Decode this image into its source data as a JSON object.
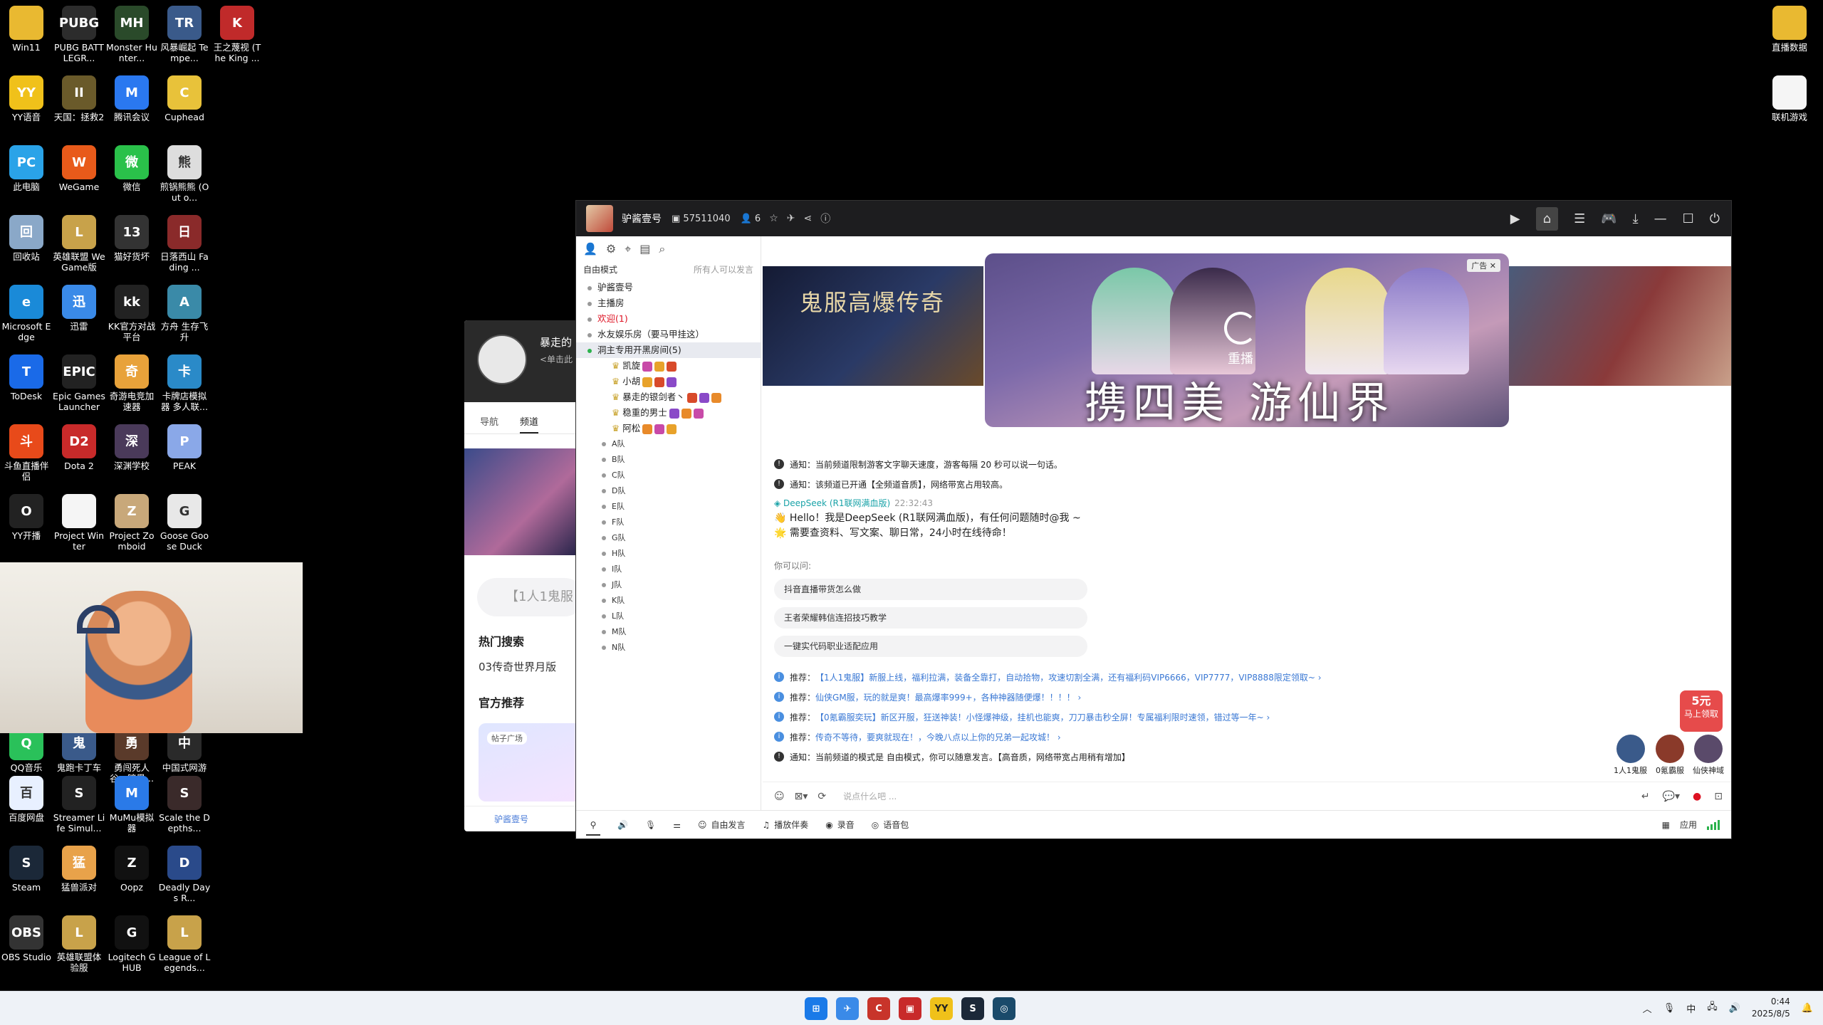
{
  "desktop": {
    "icons_left": [
      {
        "label": "Win11",
        "color": "#e9b931",
        "glyph": ""
      },
      {
        "label": "PUBG BATTLEGR...",
        "color": "#2c2c2c",
        "glyph": "PUBG"
      },
      {
        "label": "Monster Hunter...",
        "color": "#2a4a2a",
        "glyph": "MH"
      },
      {
        "label": "风暴崛起 Tempe...",
        "color": "#3a5a8a",
        "glyph": "TR"
      },
      {
        "label": "王之蔑视 (The King ...",
        "color": "#c02a2a",
        "glyph": "K"
      },
      {
        "label": "YY语音",
        "color": "#f0c11a",
        "glyph": "YY"
      },
      {
        "label": "天国：拯救2",
        "color": "#6a5a2a",
        "glyph": "II"
      },
      {
        "label": "腾讯会议",
        "color": "#2a78f0",
        "glyph": "M"
      },
      {
        "label": "Cuphead",
        "color": "#e8c23a",
        "glyph": "C"
      },
      {
        "label": "此电脑",
        "color": "#2aa3e8",
        "glyph": "PC"
      },
      {
        "label": "WeGame",
        "color": "#e85a1a",
        "glyph": "W"
      },
      {
        "label": "微信",
        "color": "#2ac14a",
        "glyph": "微"
      },
      {
        "label": "煎锅熊熊 (Out o...",
        "color": "#dddddd",
        "glyph": "熊"
      },
      {
        "label": "回收站",
        "color": "#8aa8c8",
        "glyph": "回"
      },
      {
        "label": "英雄联盟 WeGame版",
        "color": "#c8a24a",
        "glyph": "L"
      },
      {
        "label": "猫好货坏",
        "color": "#333333",
        "glyph": "13"
      },
      {
        "label": "日落西山 Fading ...",
        "color": "#8a2a2a",
        "glyph": "日"
      },
      {
        "label": "Microsoft Edge",
        "color": "#1a8ad8",
        "glyph": "e"
      },
      {
        "label": "迅雷",
        "color": "#3a8ae8",
        "glyph": "迅"
      },
      {
        "label": "KK官方对战平台",
        "color": "#222222",
        "glyph": "kk"
      },
      {
        "label": "方舟 生存飞升",
        "color": "#3a8aa8",
        "glyph": "A"
      },
      {
        "label": "ToDesk",
        "color": "#1a6ae8",
        "glyph": "T"
      },
      {
        "label": "Epic Games Launcher",
        "color": "#222222",
        "glyph": "EPIC"
      },
      {
        "label": "奇游电竞加速器",
        "color": "#e8a23a",
        "glyph": "奇"
      },
      {
        "label": "卡牌店模拟器 多人联...",
        "color": "#2a8ac8",
        "glyph": "卡"
      },
      {
        "label": "斗鱼直播伴侣",
        "color": "#e84a1a",
        "glyph": "斗"
      },
      {
        "label": "Dota 2",
        "color": "#c82a2a",
        "glyph": "D2"
      },
      {
        "label": "深渊学校",
        "color": "#4a3a5a",
        "glyph": "深"
      },
      {
        "label": "PEAK",
        "color": "#8aa8e8",
        "glyph": "P"
      },
      {
        "label": "YY开播",
        "color": "#222222",
        "glyph": "O"
      },
      {
        "label": "Project Winter",
        "color": "#f5f5f5",
        "glyph": ""
      },
      {
        "label": "Project Zomboid",
        "color": "#c8a87a",
        "glyph": "Z"
      },
      {
        "label": "Goose Goose Duck",
        "color": "#e8e8e8",
        "glyph": "G"
      },
      {
        "label": "QQ音乐",
        "color": "#2ac15a",
        "glyph": "Q"
      },
      {
        "label": "鬼跑卡丁车",
        "color": "#3a5a8a",
        "glyph": "鬼"
      },
      {
        "label": "勇闯死人谷：暗黑...",
        "color": "#5a3a2a",
        "glyph": "勇"
      },
      {
        "label": "中国式网游",
        "color": "#2a2a2a",
        "glyph": "中"
      },
      {
        "label": "百度网盘",
        "color": "#e8f0ff",
        "glyph": "百"
      },
      {
        "label": "Streamer Life Simul...",
        "color": "#222222",
        "glyph": "S"
      },
      {
        "label": "MuMu模拟器",
        "color": "#2a7ae8",
        "glyph": "M"
      },
      {
        "label": "Scale the Depths...",
        "color": "#3a2a2a",
        "glyph": "S"
      },
      {
        "label": "Steam",
        "color": "#1b2838",
        "glyph": "S"
      },
      {
        "label": "猛兽派对",
        "color": "#e8a24a",
        "glyph": "猛"
      },
      {
        "label": "Oopz",
        "color": "#111111",
        "glyph": "Z"
      },
      {
        "label": "Deadly Days R...",
        "color": "#2a4a8a",
        "glyph": "D"
      },
      {
        "label": "OBS Studio",
        "color": "#333333",
        "glyph": "OBS"
      },
      {
        "label": "英雄联盟体验服",
        "color": "#c8a24a",
        "glyph": "L"
      },
      {
        "label": "Logitech G HUB",
        "color": "#111111",
        "glyph": "G"
      },
      {
        "label": "League of Legends...",
        "color": "#c8a24a",
        "glyph": "L"
      }
    ],
    "icons_right": [
      {
        "label": "直播数据",
        "color": "#e9b931",
        "glyph": ""
      },
      {
        "label": "联机游戏",
        "color": "#f5f5f5",
        "glyph": ""
      }
    ]
  },
  "bg_window": {
    "name": "暴走的",
    "sub": "<单击此",
    "tabs": [
      "导航",
      "频道"
    ],
    "search": "【1人1鬼服",
    "hot": "热门搜索",
    "hot2": "03传奇世界月版",
    "official": "官方推荐",
    "card_tag": "帖子广场",
    "bottom": "驴酱壹号"
  },
  "yy": {
    "channel_name": "驴酱壹号",
    "channel_id": "57511040",
    "online": "6",
    "sidebar": {
      "mode": "自由模式",
      "mode_right": "所有人可以发言",
      "rooms": [
        {
          "label": "驴酱壹号",
          "style": "normal"
        },
        {
          "label": "主播房",
          "style": "normal"
        },
        {
          "label": "欢迎(1)",
          "style": "red"
        },
        {
          "label": "水友娱乐房（要马甲挂这）",
          "style": "normal"
        },
        {
          "label": "洞主专用开黑房间(5)",
          "style": "sel"
        }
      ],
      "users": [
        "凯旋",
        "小胡",
        "暴走的银剑者丶",
        "稳重的男士",
        "阿松"
      ],
      "groups": [
        "A队",
        "B队",
        "C队",
        "D队",
        "E队",
        "F队",
        "G队",
        "H队",
        "I队",
        "J队",
        "K队",
        "L队",
        "M队",
        "N队"
      ]
    },
    "stage": {
      "left_title": "鬼服高爆传奇",
      "ad_caption": "携四美 游仙界",
      "replay": "重播",
      "ad_tag": "广告"
    },
    "messages": [
      {
        "type": "notice",
        "text": "通知：当前频道限制游客文字聊天速度，游客每隔 20 秒可以说一句话。"
      },
      {
        "type": "notice",
        "text": "通知：该频道已开通【全频道音质】，网络带宽占用较高。"
      }
    ],
    "deepseek": {
      "name": "DeepSeek (R1联网满血版)",
      "time": "22:32:43",
      "line1": "👋 Hello！我是DeepSeek (R1联网满血版)，有任何问题随时@我 ~",
      "line2": "🌟 需要查资料、写文案、聊日常，24小时在线待命！"
    },
    "ask_label": "你可以问:",
    "chips": [
      "抖音直播带货怎么做",
      "王者荣耀韩信连招技巧教学",
      "一键实代码职业适配应用"
    ],
    "recs": [
      {
        "prefix": "推荐：",
        "text": "【1人1鬼服】新服上线，福利拉满，装备全靠打，自动拾物，攻速切割全满，还有福利码VIP6666，VIP7777，VIP8888限定领取~ ›"
      },
      {
        "prefix": "推荐：",
        "text": "仙侠GM服，玩的就是爽！最高爆率999+，各种神器随便爆！！！！ ›"
      },
      {
        "prefix": "推荐：",
        "text": "【0氪霸服奕玩】新区开服，狂送神装！小怪爆神级，挂机也能爽，刀刀暴击秒全屏！专属福利限时速领，错过等一年~ ›"
      },
      {
        "prefix": "推荐：",
        "text": "传奇不等待，要爽就现在！，今晚八点以上你的兄弟一起攻城！ ›"
      }
    ],
    "last_notice": "通知：当前频道的模式是 自由模式，你可以随意发言。【高音质，网络带宽占用稍有增加】",
    "input_placeholder": "说点什么吧 ...",
    "promo": {
      "line1": "5元",
      "line2": "马上领取"
    },
    "avatars": [
      {
        "label": "1人1鬼服",
        "color": "#3a5a8a"
      },
      {
        "label": "0氪霸服",
        "color": "#8a3a2a"
      },
      {
        "label": "仙侠神域",
        "color": "#5a4a6a"
      }
    ],
    "bottombar": [
      {
        "icon": "mic-icon",
        "label": "自由发言"
      },
      {
        "icon": "music-icon",
        "label": "播放伴奏"
      },
      {
        "icon": "record-icon",
        "label": "录音"
      },
      {
        "icon": "voice-bag-icon",
        "label": "语音包"
      }
    ],
    "apps_label": "应用"
  },
  "taskbar": {
    "apps": [
      {
        "name": "windows-start-icon",
        "color": "#1a7ae8",
        "glyph": "⊞"
      },
      {
        "name": "xunlei-icon",
        "color": "#3a8ae8",
        "glyph": "✈"
      },
      {
        "name": "chrome-icon",
        "color": "#c8342a",
        "glyph": "C"
      },
      {
        "name": "game-icon",
        "color": "#c82a2a",
        "glyph": "▣"
      },
      {
        "name": "yy-icon",
        "color": "#f0c11a",
        "glyph": "YY"
      },
      {
        "name": "steam-icon",
        "color": "#1b2838",
        "glyph": "S"
      },
      {
        "name": "app-icon",
        "color": "#1a4a6a",
        "glyph": "◎"
      }
    ],
    "ime": "中",
    "time": "0:44",
    "date": "2025/8/5"
  }
}
